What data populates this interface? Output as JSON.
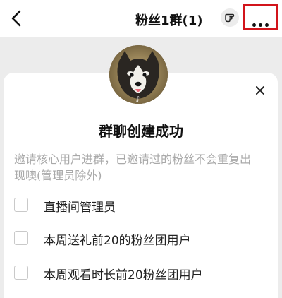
{
  "header": {
    "title": "粉丝1群(1)",
    "back_icon": "chevron-left-icon",
    "gesture_icon": "hand-pointer-icon",
    "more_icon": "more-dots-icon",
    "highlight_color": "#d2141b"
  },
  "dialog": {
    "close_icon": "close-icon",
    "title": "群聊创建成功",
    "description": "邀请核心用户进群，已邀请过的粉丝不会重复出现噢(管理员除外)",
    "options": [
      {
        "label": "直播间管理员",
        "checked": false
      },
      {
        "label": "本周送礼前20的粉丝团用户",
        "checked": false
      },
      {
        "label": "本周观看时长前20粉丝团用户",
        "checked": false
      }
    ]
  }
}
